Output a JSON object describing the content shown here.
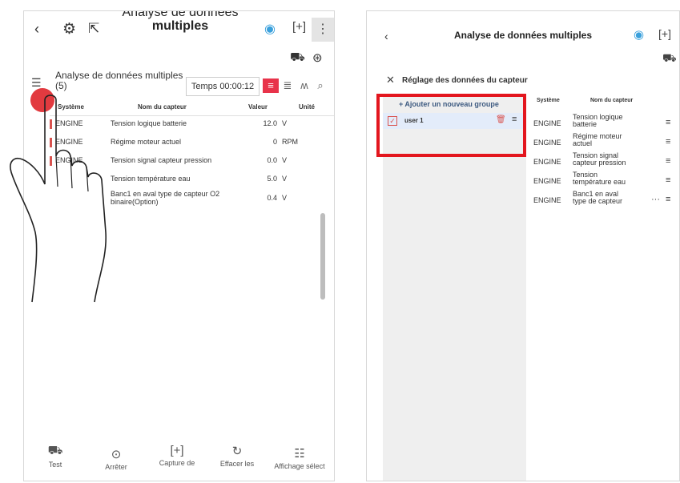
{
  "left_screen": {
    "topbar": {
      "back_icon": "back-chevron-icon",
      "title_line1": "Analyse de données",
      "title_line2": "multiples",
      "right_icons": [
        "record-icon",
        "screenshot-icon",
        "more-vertical-icon"
      ],
      "second_row_icons": [
        "car-scan-icon",
        "waveform-icon"
      ]
    },
    "header": {
      "title": "Analyse de données multiples",
      "count": "(5)",
      "timer_label": "Temps 00:00:12",
      "view_modes": [
        "list-view-icon",
        "text-view-icon",
        "graph-view-icon",
        "search-icon"
      ]
    },
    "table": {
      "columns": [
        "Système",
        "Nom du capteur",
        "Valeur",
        "Unité"
      ],
      "rows": [
        {
          "system": "ENGINE",
          "name": "Tension logique batterie",
          "value": "12.0",
          "unit": "V"
        },
        {
          "system": "ENGINE",
          "name": "Régime moteur actuel",
          "value": "0",
          "unit": "RPM"
        },
        {
          "system": "ENGINE",
          "name": "Tension signal capteur pression",
          "value": "0.0",
          "unit": "V"
        },
        {
          "system": "",
          "name": "Tension température eau",
          "value": "5.0",
          "unit": "V"
        },
        {
          "system": "",
          "name": "Banc1 en aval type de capteur O2 binaire(Option)",
          "value": "0.4",
          "unit": "V"
        }
      ]
    },
    "bottom_bar": [
      {
        "icon": "car-test-icon",
        "label": "Test"
      },
      {
        "icon": "stop-icon",
        "label": "Arrêter"
      },
      {
        "icon": "capture-icon",
        "label": "Capture de"
      },
      {
        "icon": "refresh-icon",
        "label": "Effacer les"
      },
      {
        "icon": "display-select-icon",
        "label": "Affichage sélect"
      }
    ]
  },
  "right_screen": {
    "topbar": {
      "title": "Analyse de données multiples",
      "right_icons": [
        "record-icon",
        "screenshot-icon"
      ],
      "second_row_icon": "car-scan-icon"
    },
    "dialog": {
      "title": "Réglage des données du capteur",
      "add_group_label": "+ Ajouter un nouveau groupe",
      "groups": [
        {
          "name": "user 1",
          "checked": true
        }
      ]
    },
    "sensor_table": {
      "columns": [
        "Système",
        "Nom du capteur"
      ],
      "rows": [
        {
          "system": "ENGINE",
          "name": "Tension logique batterie"
        },
        {
          "system": "ENGINE",
          "name": "Régime moteur actuel"
        },
        {
          "system": "ENGINE",
          "name": "Tension signal capteur pression"
        },
        {
          "system": "ENGINE",
          "name": "Tension température eau"
        },
        {
          "system": "ENGINE",
          "name": "Banc1 en aval type de capteur"
        }
      ]
    }
  },
  "colors": {
    "accent_red": "#e23a3f",
    "highlight_red": "#e3161e",
    "record_blue": "#3aa0dc"
  }
}
